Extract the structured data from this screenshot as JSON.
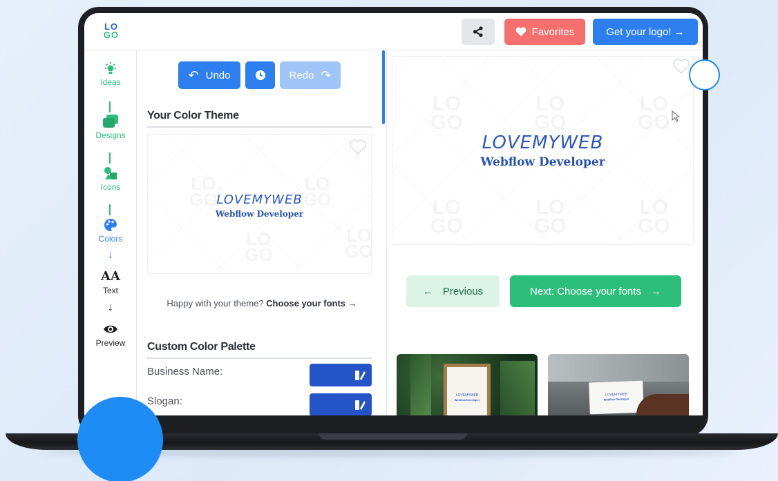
{
  "app": {
    "logo_top": "LO",
    "logo_bottom": "GO"
  },
  "header": {
    "favorites_label": "Favorites",
    "get_logo_label": "Get your logo! →"
  },
  "sidebar": {
    "items": [
      {
        "label": "Ideas",
        "icon": "lightbulb-icon"
      },
      {
        "label": "Designs",
        "icon": "layers-icon"
      },
      {
        "label": "Icons",
        "icon": "shapes-icon"
      },
      {
        "label": "Colors",
        "icon": "palette-icon"
      },
      {
        "label": "Text",
        "icon": "text-icon"
      },
      {
        "label": "Preview",
        "icon": "eye-icon"
      }
    ]
  },
  "toolbar": {
    "undo_label": "Undo",
    "redo_label": "Redo"
  },
  "color_theme": {
    "title": "Your Color Theme",
    "hint_prefix": "Happy with your theme? ",
    "hint_link": "Choose your fonts →"
  },
  "custom_palette": {
    "title": "Custom Color Palette",
    "fields": [
      {
        "label": "Business Name:",
        "color": "#2553c8"
      },
      {
        "label": "Slogan:",
        "color": "#2553c8"
      }
    ]
  },
  "logo_preview": {
    "brand_name": "LOVEMYWEB",
    "slogan": "Webflow Developer",
    "watermark": "LO GO"
  },
  "navigation": {
    "previous_label": "Previous",
    "next_label": "Next: Choose your fonts"
  },
  "mockups": {
    "brand_name": "LOVEMYWEB",
    "slogan": "Webflow Developer"
  },
  "colors": {
    "primary": "#2d7ff0",
    "green": "#2bbf7a",
    "favorites": "#f56f6f",
    "brand_blue": "#2553c8"
  }
}
